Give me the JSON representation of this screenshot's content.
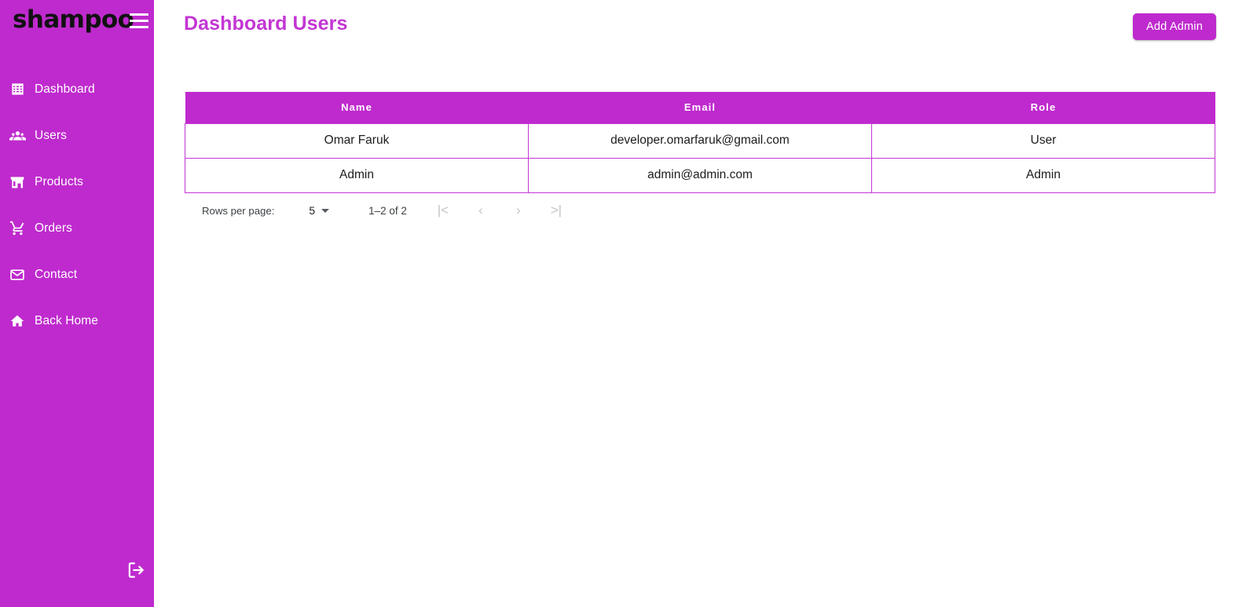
{
  "sidebar": {
    "brand": "shampoo",
    "menu_icon": "hamburger-icon",
    "items": [
      {
        "label": "Dashboard",
        "icon": "grid-icon"
      },
      {
        "label": "Users",
        "icon": "people-group-icon"
      },
      {
        "label": "Products",
        "icon": "store-icon"
      },
      {
        "label": "Orders",
        "icon": "shopping-cart-icon"
      },
      {
        "label": "Contact",
        "icon": "envelope-icon"
      },
      {
        "label": "Back Home",
        "icon": "home-icon"
      }
    ],
    "logout_icon": "logout-icon",
    "background_color": "#bf2ace"
  },
  "header": {
    "title": "Dashboard Users",
    "title_color": "#c336d4",
    "add_admin_label": "Add Admin",
    "accent_color": "#bf2ace"
  },
  "table": {
    "columns": [
      "Name",
      "Email",
      "Role"
    ],
    "rows": [
      {
        "name": "Omar Faruk",
        "email": "developer.omarfaruk@gmail.com",
        "role": "User"
      },
      {
        "name": "Admin",
        "email": "admin@admin.com",
        "role": "Admin"
      }
    ],
    "border_color": "#c336d4"
  },
  "pagination": {
    "rows_per_page_label": "Rows per page:",
    "rows_per_page_value": "5",
    "range_label": "1–2 of 2",
    "first_page_icon": "|<",
    "prev_page_icon": "‹",
    "next_page_icon": "›",
    "last_page_icon": ">|"
  }
}
